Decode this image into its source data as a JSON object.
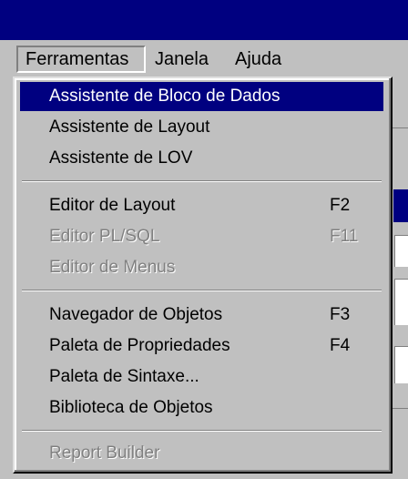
{
  "menubar": {
    "items": [
      {
        "label": "Ferramentas",
        "active": true
      },
      {
        "label": "Janela",
        "active": false
      },
      {
        "label": "Ajuda",
        "active": false
      }
    ]
  },
  "menu": {
    "items": [
      {
        "label": "Assistente de Bloco de Dados",
        "shortcut": "",
        "state": "selected"
      },
      {
        "label": "Assistente de Layout",
        "shortcut": "",
        "state": "enabled"
      },
      {
        "label": "Assistente de LOV",
        "shortcut": "",
        "state": "enabled"
      },
      {
        "label": "Editor de Layout",
        "shortcut": "F2",
        "state": "enabled"
      },
      {
        "label": "Editor PL/SQL",
        "shortcut": "F11",
        "state": "disabled"
      },
      {
        "label": "Editor de Menus",
        "shortcut": "",
        "state": "disabled"
      },
      {
        "label": "Navegador de Objetos",
        "shortcut": "F3",
        "state": "enabled"
      },
      {
        "label": "Paleta de Propriedades",
        "shortcut": "F4",
        "state": "enabled"
      },
      {
        "label": "Paleta de Sintaxe...",
        "shortcut": "",
        "state": "enabled"
      },
      {
        "label": "Biblioteca de Objetos",
        "shortcut": "",
        "state": "enabled"
      },
      {
        "label": "Report Builder",
        "shortcut": "",
        "state": "disabled"
      }
    ]
  },
  "colors": {
    "titlebar": "#000080",
    "face": "#c0c0c0",
    "highlight": "#000080",
    "disabled_text": "#808080"
  }
}
